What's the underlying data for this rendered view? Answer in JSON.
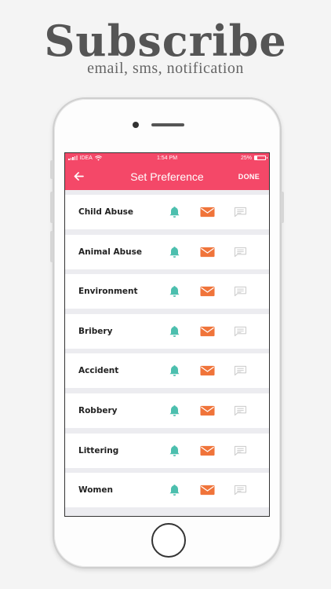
{
  "promo": {
    "headline": "Subscribe",
    "subline": "email, sms, notification"
  },
  "status_bar": {
    "carrier": "IDEA",
    "time": "1:54 PM",
    "battery": "25%"
  },
  "app_bar": {
    "title": "Set Preference",
    "done_label": "DONE"
  },
  "colors": {
    "accent": "#f44868",
    "bell": "#4cbfae",
    "email": "#f0743a",
    "sms_inactive": "#d6d6d6"
  },
  "preferences": [
    {
      "label": "Child Abuse"
    },
    {
      "label": "Animal Abuse"
    },
    {
      "label": "Environment"
    },
    {
      "label": "Bribery"
    },
    {
      "label": "Accident"
    },
    {
      "label": "Robbery"
    },
    {
      "label": "Littering"
    },
    {
      "label": "Women"
    }
  ]
}
